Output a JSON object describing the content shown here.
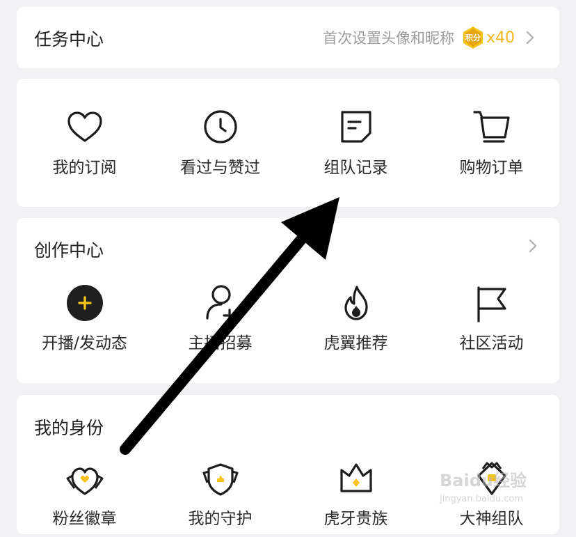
{
  "task_center": {
    "title": "任务中心",
    "description": "首次设置头像和昵称",
    "points_badge": "积分",
    "points_count": "x40",
    "accent_color": "#f3b71f"
  },
  "quick_links": [
    {
      "label": "我的订阅",
      "icon": "heart-icon"
    },
    {
      "label": "看过与赞过",
      "icon": "clock-icon"
    },
    {
      "label": "组队记录",
      "icon": "note-icon"
    },
    {
      "label": "购物订单",
      "icon": "cart-icon"
    }
  ],
  "creation_center": {
    "title": "创作中心",
    "items": [
      {
        "label": "开播/发动态",
        "icon": "plus-circle-icon"
      },
      {
        "label": "主播招募",
        "icon": "add-user-icon"
      },
      {
        "label": "虎翼推荐",
        "icon": "flame-icon"
      },
      {
        "label": "社区活动",
        "icon": "flag-icon"
      }
    ]
  },
  "identity": {
    "title": "我的身份",
    "items": [
      {
        "label": "粉丝徽章",
        "icon": "fan-badge-icon"
      },
      {
        "label": "我的守护",
        "icon": "guard-shield-icon"
      },
      {
        "label": "虎牙贵族",
        "icon": "crown-icon"
      },
      {
        "label": "大神组队",
        "icon": "team-badge-icon"
      }
    ]
  },
  "watermark": {
    "main": "Baidu经验",
    "sub": "jingyan.baidu.com"
  }
}
